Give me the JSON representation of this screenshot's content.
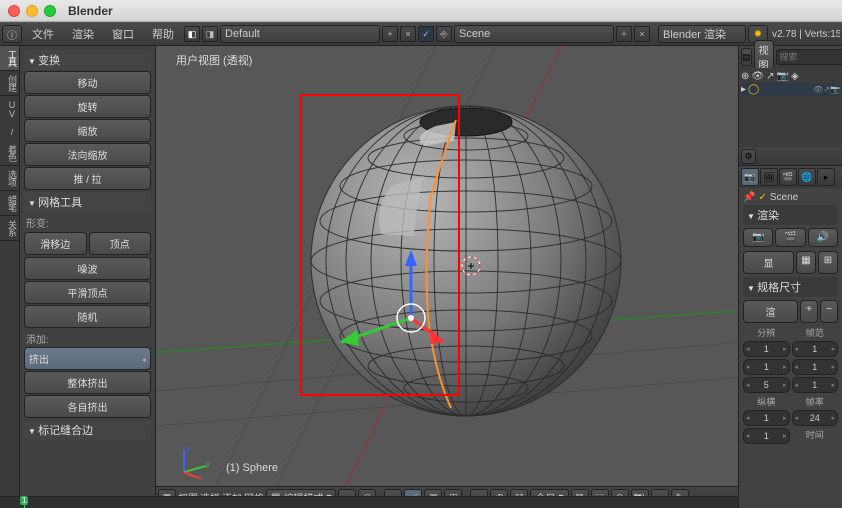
{
  "title": "Blender",
  "menu": {
    "file": "文件",
    "render": "渲染",
    "window": "窗口",
    "help": "帮助"
  },
  "layout": "Default",
  "scene": "Scene",
  "render_engine": "Blender 渲染",
  "version": "v2.78",
  "stats": "Verts:15",
  "toolshelf": {
    "tabs": [
      "工具",
      "创建",
      "UV / 着色",
      "选项",
      "蜡笔",
      "关系"
    ],
    "transform_header": "变换",
    "translate": "移动",
    "rotate": "旋转",
    "scale": "缩放",
    "normal_scale": "法向缩放",
    "push_pull": "推 / 拉",
    "mesh_tools_header": "网格工具",
    "deform_label": "形变:",
    "slide_edge": "滑移边",
    "vertex": "顶点",
    "noise": "噪波",
    "smooth_vertex": "平滑顶点",
    "randomize": "随机",
    "add_label": "添加:",
    "extrude": "挤出",
    "extrude_all": "整体挤出",
    "extrude_individual": "各自挤出",
    "mark_seam_header": "标记缝合边"
  },
  "viewport": {
    "label": "用户视图 (透视)",
    "object_label": "(1) Sphere",
    "header": {
      "view": "视图",
      "select": "选择",
      "add": "添加",
      "mesh": "网格",
      "mode": "编辑模式",
      "transform": "全局"
    }
  },
  "outliner": {
    "view_btn": "视图",
    "search_placeholder": "搜索",
    "scene_name": "Scene"
  },
  "properties": {
    "render_header": "渲染",
    "display_label": "显",
    "dimensions_header": "规格尺寸",
    "render_preset": "渲",
    "res_label": "分辨",
    "frame_label": "帧范",
    "aspect_label": "纵横",
    "fps_label": "帧率",
    "v1": "1",
    "v1b": "1",
    "v5": "5",
    "fps": "24",
    "v1c": "1",
    "v1d": "1",
    "time_label": "时间"
  },
  "timeline_frame": "1"
}
